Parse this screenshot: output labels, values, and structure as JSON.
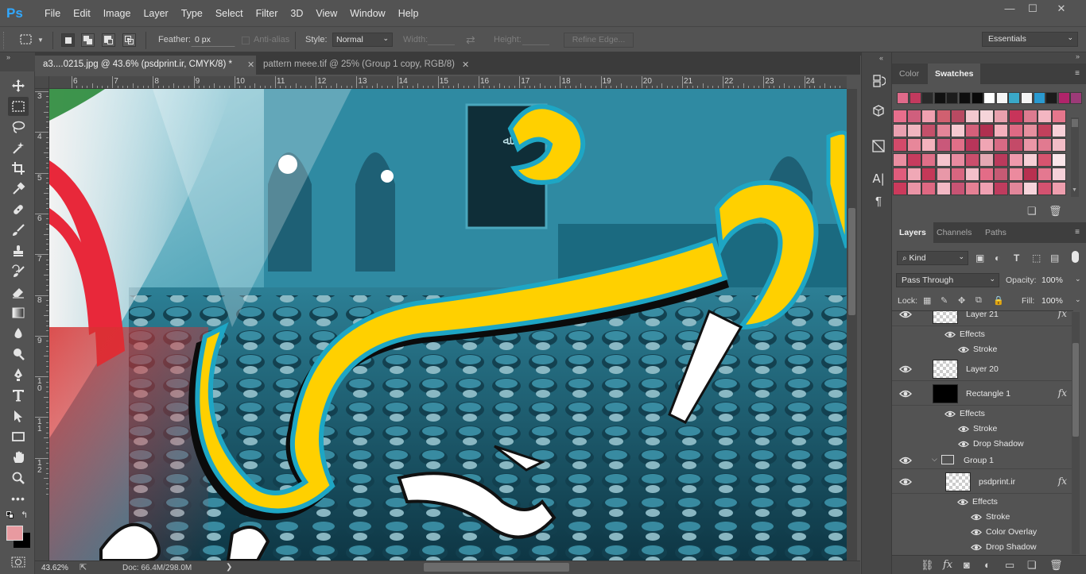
{
  "app": {
    "logo": "Ps",
    "menus": [
      "File",
      "Edit",
      "Image",
      "Layer",
      "Type",
      "Select",
      "Filter",
      "3D",
      "View",
      "Window",
      "Help"
    ],
    "window_controls": {
      "minimize": "—",
      "restore": "☐",
      "close": "✕"
    }
  },
  "options": {
    "feather_label": "Feather:",
    "feather_value": "0 px",
    "antialias_label": "Anti-alias",
    "style_label": "Style:",
    "style_value": "Normal",
    "width_label": "Width:",
    "height_label": "Height:",
    "refine_edge": "Refine Edge...",
    "workspace": "Essentials"
  },
  "tabs": [
    {
      "label": "a3....0215.jpg @ 43.6% (psdprint.ir, CMYK/8) *",
      "active": true
    },
    {
      "label": "pattern meee.tif @ 25% (Group 1 copy, RGB/8)",
      "active": false
    }
  ],
  "rulers": {
    "top": [
      "6",
      "7",
      "8",
      "9",
      "10",
      "11",
      "12",
      "13",
      "14",
      "15",
      "16",
      "17",
      "18",
      "19",
      "20",
      "21",
      "22",
      "23",
      "24"
    ],
    "left": [
      "3",
      "4",
      "5",
      "6",
      "7",
      "8",
      "9",
      "1 0",
      "1 1",
      "1 2"
    ]
  },
  "status": {
    "zoom": "43.62%",
    "doc": "Doc: 66.4M/298.0M",
    "arrow": "❯"
  },
  "panels": {
    "top_tabs": [
      "Color",
      "Swatches"
    ],
    "layers_tabs": [
      "Layers",
      "Channels",
      "Paths"
    ],
    "filter_kind": "Kind",
    "blend_mode": "Pass Through",
    "opacity_label": "Opacity:",
    "opacity_value": "100%",
    "lock_label": "Lock:",
    "fill_label": "Fill:",
    "fill_value": "100%"
  },
  "swatch_colors": {
    "top_row": [
      "#e06a8a",
      "#c23a5e",
      "#2a2a2a",
      "#111111",
      "#1c1c1c",
      "#0e0e0e",
      "#0a0a0a",
      "#ffffff",
      "#f6f6f6",
      "#3aa8c8",
      "#f4f4f4",
      "#2a9ad0",
      "#1b1b1b",
      "#b0246a",
      "#9c3a78"
    ],
    "grid": [
      [
        "#e86e8c",
        "#cf5f7d",
        "#f0a0b0",
        "#d06070",
        "#b84a62",
        "#f2c8cf",
        "#f5d5da",
        "#e8a0ad",
        "#c8345a",
        "#dd7b90",
        "#f3b6c2",
        "#e6768c"
      ],
      [
        "#eaa0b0",
        "#f0b6c0",
        "#c4506a",
        "#e38598",
        "#f6c9d0",
        "#d4607a",
        "#b03050",
        "#f4b0bc",
        "#de6a84",
        "#e6909f",
        "#c2405c",
        "#f8d0d8"
      ],
      [
        "#d34a6a",
        "#e7879a",
        "#f3b2bd",
        "#c9587a",
        "#e06f88",
        "#b8355a",
        "#f0a5b4",
        "#d86a84",
        "#c44a68",
        "#ea96a6",
        "#e17a90",
        "#f2bcc6"
      ],
      [
        "#ea8ea1",
        "#c63c5e",
        "#df6f88",
        "#f5c4cd",
        "#e88ba0",
        "#ca4e6c",
        "#e5a8b4",
        "#bb3a5c",
        "#ee9aac",
        "#f6cfd6",
        "#d6546f",
        "#fbe6ea"
      ],
      [
        "#e05c7c",
        "#f0a8b6",
        "#c43858",
        "#e898a8",
        "#d86680",
        "#f3c0ca",
        "#e36c87",
        "#c65a74",
        "#ec8a9e",
        "#b83050",
        "#e47890",
        "#f5d0d8"
      ],
      [
        "#cc3a5c",
        "#ea94a6",
        "#df6882",
        "#f2b8c4",
        "#c85474",
        "#e58094",
        "#f0a0b2",
        "#bf3c5e",
        "#e2869a",
        "#f6d4db",
        "#d45270",
        "#ee9eae"
      ]
    ]
  },
  "layers": [
    {
      "type": "layer",
      "name": "Layer 21",
      "fx": "fx"
    },
    {
      "type": "effects",
      "name": "Effects"
    },
    {
      "type": "effect",
      "name": "Stroke"
    },
    {
      "type": "layer",
      "name": "Layer 20",
      "fx": ""
    },
    {
      "type": "layer",
      "name": "Rectangle 1",
      "fx": "fx"
    },
    {
      "type": "effects",
      "name": "Effects"
    },
    {
      "type": "effect",
      "name": "Stroke"
    },
    {
      "type": "effect",
      "name": "Drop Shadow"
    },
    {
      "type": "group",
      "name": "Group 1"
    },
    {
      "type": "layer",
      "name": "psdprint.ir",
      "fx": "fx"
    },
    {
      "type": "effects",
      "name": "Effects"
    },
    {
      "type": "effect",
      "name": "Stroke"
    },
    {
      "type": "effect",
      "name": "Color Overlay"
    },
    {
      "type": "effect",
      "name": "Drop Shadow"
    }
  ],
  "colors": {
    "foreground": "#e89aa0",
    "background": "#000000",
    "accent_blue": "#31a8ff",
    "artwork_yellow": "#ffd000",
    "artwork_cyan": "#1ea6c4"
  }
}
